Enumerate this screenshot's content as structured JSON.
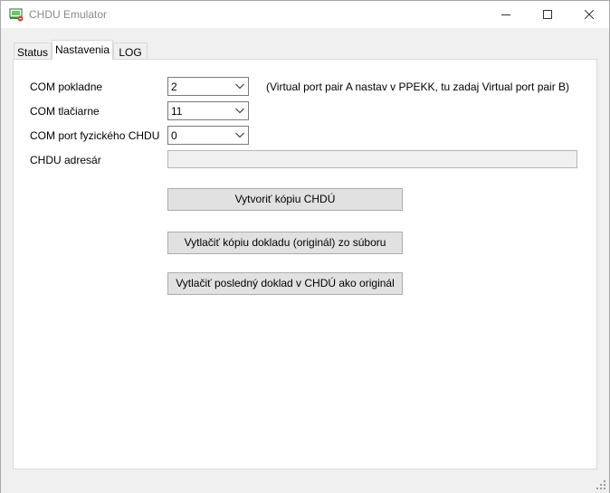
{
  "window": {
    "title": "CHDU Emulator"
  },
  "tabs": [
    {
      "label": "Status"
    },
    {
      "label": "Nastavenia"
    },
    {
      "label": "LOG"
    }
  ],
  "settings": {
    "com_pokladne": {
      "label": "COM pokladne",
      "value": "2"
    },
    "com_pokladne_hint": "(Virtual port pair A nastav v PPEKK, tu zadaj Virtual port pair B)",
    "com_tlaciarne": {
      "label": "COM tlačiarne",
      "value": "11"
    },
    "com_chdu": {
      "label": "COM port fyzického CHDU",
      "value": "0"
    },
    "chdu_adresar": {
      "label": "CHDU adresár",
      "value": ""
    }
  },
  "actions": {
    "create_copy": "Vytvoriť kópiu CHDÚ",
    "print_copy": "Vytlačiť kópiu dokladu (originál) zo súboru",
    "print_last": "Vytlačiť posledný doklad v CHDÚ ako originál"
  },
  "icons": {
    "app": "app-monitor-icon",
    "minimize": "minimize-icon",
    "maximize": "maximize-icon",
    "close": "close-icon",
    "dropdown": "chevron-down-icon",
    "grip": "resize-grip-icon"
  }
}
